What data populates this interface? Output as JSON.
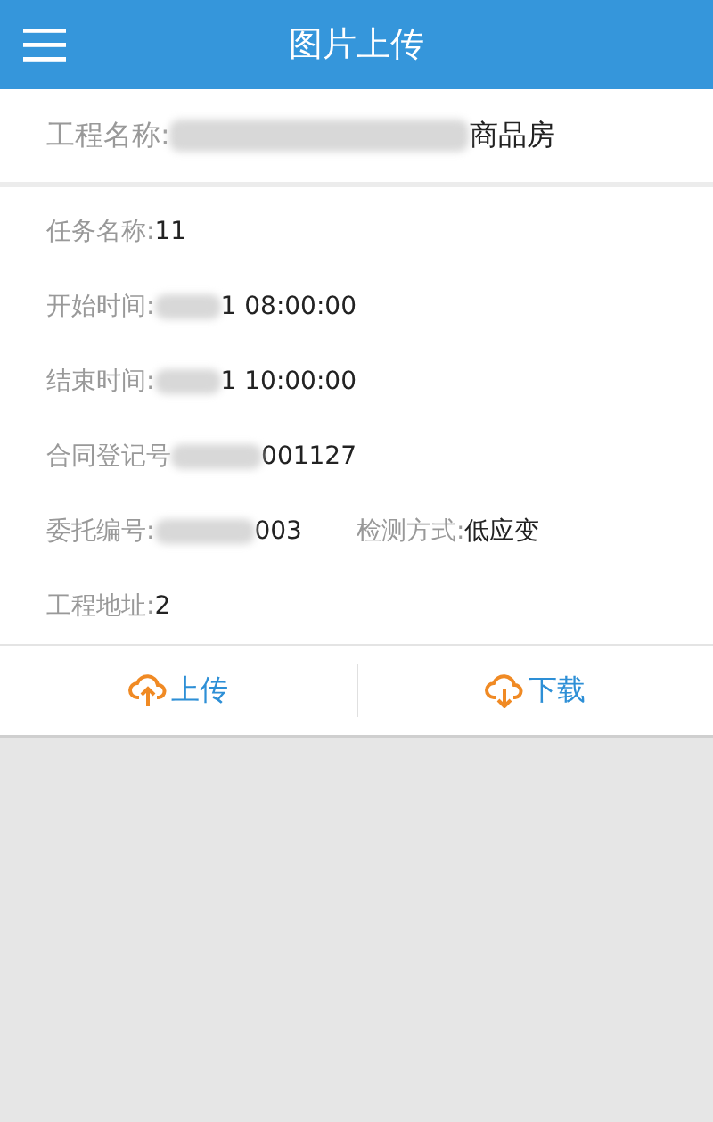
{
  "header": {
    "title": "图片上传"
  },
  "project": {
    "label": "工程名称:",
    "redacted": true,
    "value": "商品房"
  },
  "fields": [
    {
      "label": "任务名称:",
      "redacted": false,
      "value": "11"
    },
    {
      "label": "开始时间:",
      "redacted": true,
      "value": "1 08:00:00"
    },
    {
      "label": "结束时间:",
      "redacted": true,
      "value": "1 10:00:00"
    },
    {
      "label": "合同登记号",
      "redacted": true,
      "value": "001127"
    },
    {
      "label": "委托编号:",
      "redacted": true,
      "value": "003",
      "extra": {
        "label": "检测方式:",
        "value": "低应变"
      }
    },
    {
      "label": "工程地址:",
      "redacted": false,
      "value": "2"
    }
  ],
  "actions": [
    {
      "kind": "upload",
      "label": "上传"
    },
    {
      "kind": "download",
      "label": "下载"
    }
  ]
}
